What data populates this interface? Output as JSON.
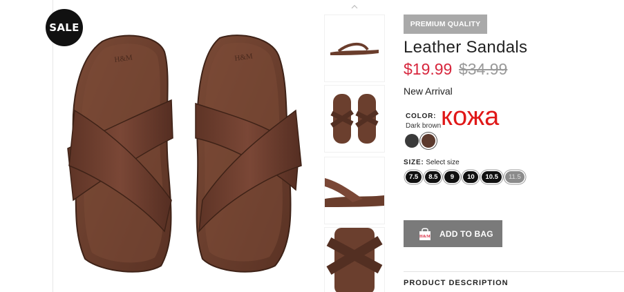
{
  "product": {
    "sale_badge": "SALE",
    "premium_badge": "PREMIUM QUALITY",
    "title": "Leather Sandals",
    "price_sale": "$19.99",
    "price_original": "$34.99",
    "new_arrival": "New Arrival",
    "color_label": "COLOR:",
    "color_value": "Dark brown",
    "overlay_text": "кожа",
    "colors": [
      {
        "name": "dark-grey",
        "hex": "#3a3a3a"
      },
      {
        "name": "dark-brown",
        "hex": "#5c3a2e",
        "selected": true
      }
    ],
    "size_label": "SIZE:",
    "size_prompt": "Select size",
    "sizes": [
      "7.5",
      "8.5",
      "9",
      "10",
      "10.5",
      "11.5"
    ],
    "disabled_sizes": [
      "11.5"
    ],
    "add_to_bag": "ADD TO BAG",
    "bag_logo": "H&M",
    "product_description": "PRODUCT DESCRIPTION"
  },
  "colors": {
    "sale_red": "#d7263d",
    "overlay_red": "#e01818",
    "leather": "#6b3f2e",
    "button_grey": "#7a7a7a",
    "badge_grey": "#a9a9a9"
  },
  "icons": {
    "thumb_scroll": "chevron-up-icon",
    "bag": "shopping-bag-icon"
  }
}
